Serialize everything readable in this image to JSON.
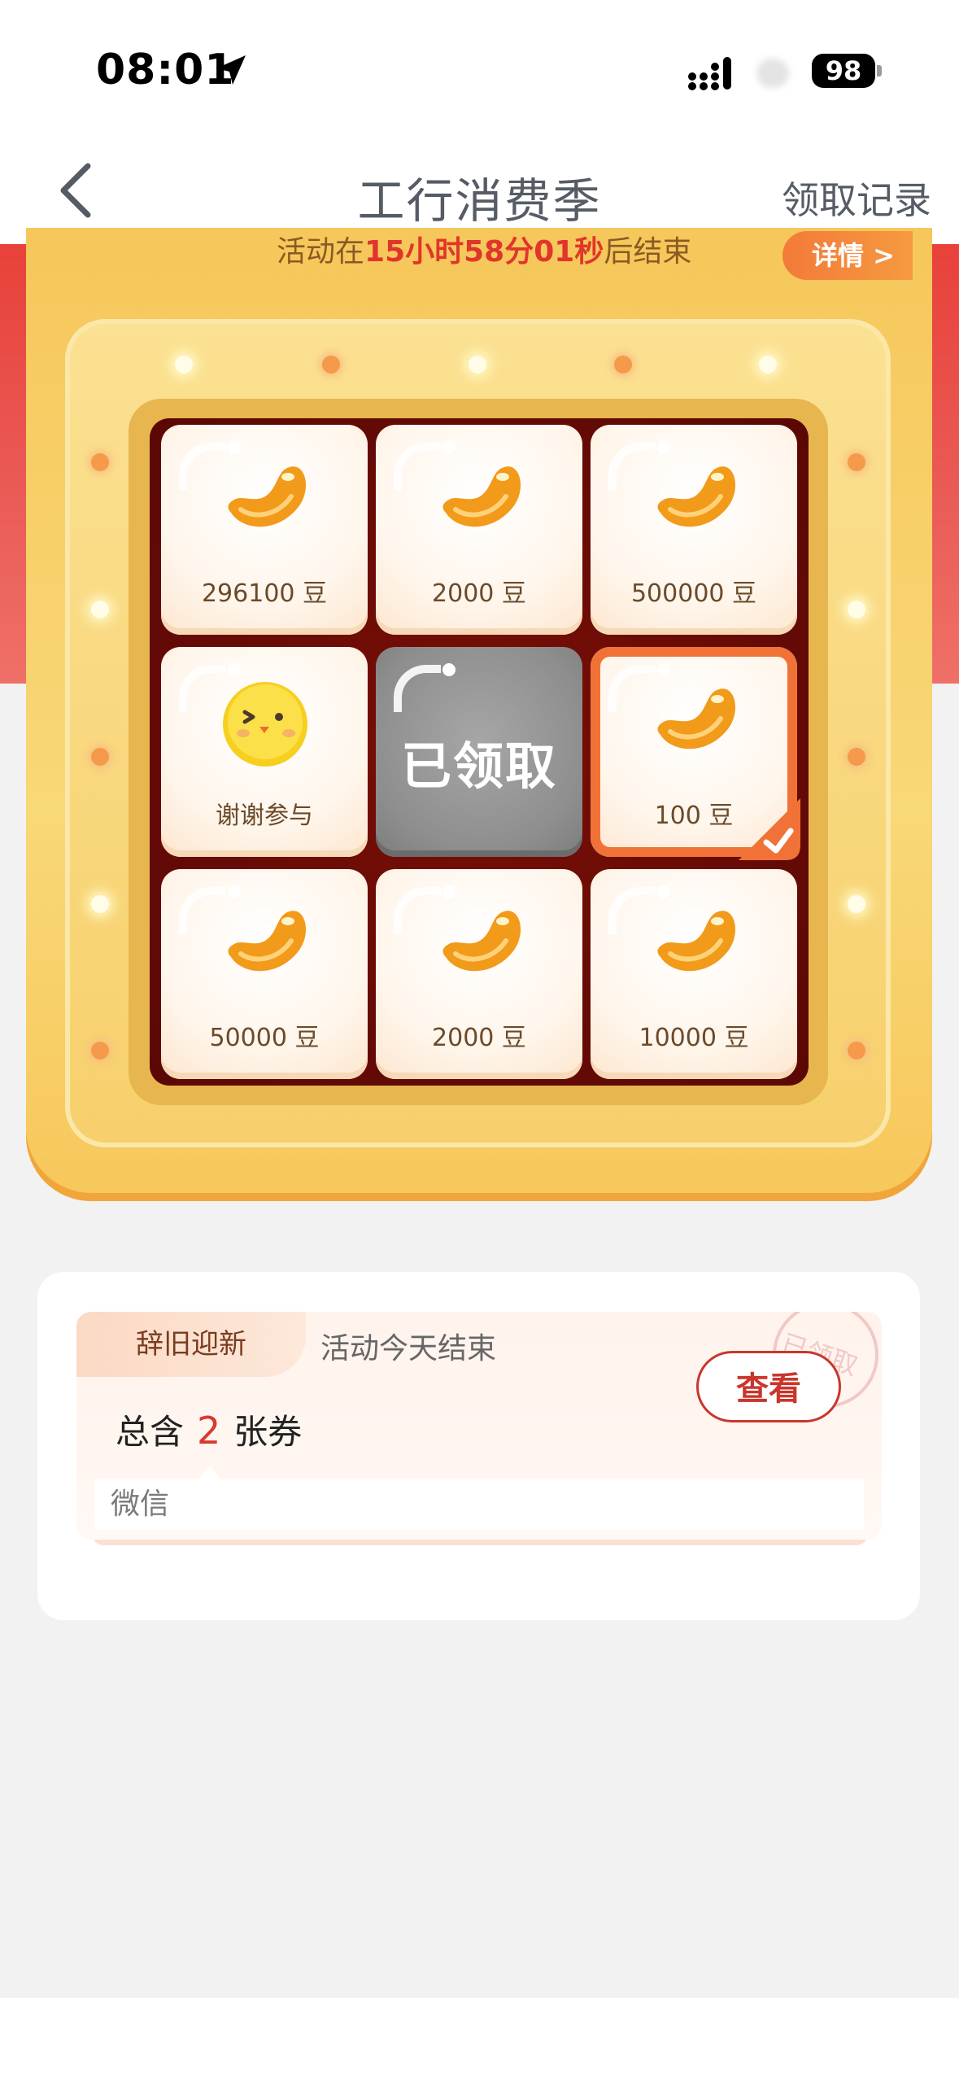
{
  "status_bar": {
    "time": "08:01",
    "battery": "98"
  },
  "nav": {
    "title": "工行消费季",
    "record": "领取记录"
  },
  "banner": {
    "countdown_prefix": "活动在",
    "countdown_time": "15小时58分01秒",
    "countdown_suffix": "后结束",
    "details": "详情 >"
  },
  "grid": [
    {
      "label": "296100 豆"
    },
    {
      "label": "2000 豆"
    },
    {
      "label": "500000 豆"
    },
    {
      "label": "谢谢参与"
    },
    {
      "label": "已领取"
    },
    {
      "label": "100 豆"
    },
    {
      "label": "50000 豆"
    },
    {
      "label": "2000 豆"
    },
    {
      "label": "10000 豆"
    }
  ],
  "coupon": {
    "tag": "辞旧迎新",
    "subtitle": "活动今天结束",
    "count_prefix": "总含",
    "count": "2",
    "count_suffix": "张券",
    "view_button": "查看",
    "stamp": "已领取",
    "channel": "微信"
  },
  "colors": {
    "accent_red": "#e1352b",
    "gold": "#f6c75a",
    "selected_border": "#f07236"
  }
}
